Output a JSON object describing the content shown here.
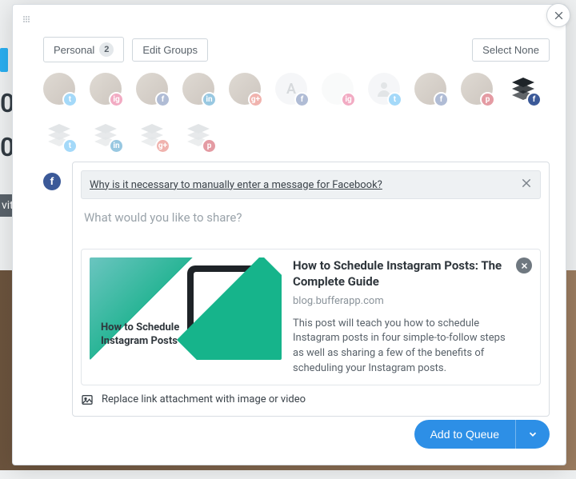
{
  "background": {
    "num1": "0",
    "num2": "0",
    "with": "vith"
  },
  "header": {
    "personal_label": "Personal",
    "personal_count": "2",
    "edit_groups_label": "Edit Groups",
    "select_none_label": "Select None"
  },
  "profiles": {
    "row1": [
      {
        "kind": "avatar",
        "network": "tw",
        "name": "twitter-profile",
        "glyph": "t"
      },
      {
        "kind": "avatar",
        "network": "ig",
        "name": "instagram-profile",
        "glyph": "ig"
      },
      {
        "kind": "avatar",
        "network": "fb",
        "name": "facebook-profile",
        "glyph": "f"
      },
      {
        "kind": "avatar",
        "network": "li",
        "name": "linkedin-profile",
        "glyph": "in"
      },
      {
        "kind": "avatar",
        "network": "gp",
        "name": "googleplus-profile",
        "glyph": "g+"
      },
      {
        "kind": "letter",
        "letter": "A",
        "network": "fb",
        "name": "facebook-page-a",
        "glyph": "f"
      },
      {
        "kind": "blank",
        "network": "ig",
        "name": "instagram-profile-2",
        "glyph": "ig"
      },
      {
        "kind": "silhouette",
        "network": "tw",
        "name": "twitter-profile-2",
        "glyph": "t"
      },
      {
        "kind": "avatar",
        "network": "fb",
        "name": "facebook-profile-2",
        "glyph": "f"
      },
      {
        "kind": "avatar",
        "network": "pi",
        "name": "pinterest-profile",
        "glyph": "p"
      },
      {
        "kind": "stack",
        "network": "fb",
        "name": "facebook-group",
        "glyph": "f",
        "selected": true
      }
    ],
    "row2": [
      {
        "kind": "stack",
        "network": "tw",
        "name": "twitter-group",
        "glyph": "t"
      },
      {
        "kind": "stack",
        "network": "li",
        "name": "linkedin-group",
        "glyph": "in"
      },
      {
        "kind": "stack",
        "network": "gp",
        "name": "googleplus-group",
        "glyph": "g+"
      },
      {
        "kind": "stack",
        "network": "pi",
        "name": "pinterest-group",
        "glyph": "p"
      }
    ]
  },
  "composer": {
    "info_link_text": "Why is it necessary to manually enter a message for Facebook?",
    "placeholder": "What would you like to share?",
    "card": {
      "title": "How to Schedule Instagram Posts: The Complete Guide",
      "domain": "blog.bufferapp.com",
      "description": "This post will teach you how to schedule Instagram posts in four simple-to-follow steps as well as sharing a few of the benefits of scheduling your Instagram posts.",
      "thumb_caption": "How to Schedule Instagram Posts"
    },
    "replace_label": "Replace link attachment with image or video"
  },
  "footer": {
    "add_to_queue_label": "Add to Queue"
  }
}
